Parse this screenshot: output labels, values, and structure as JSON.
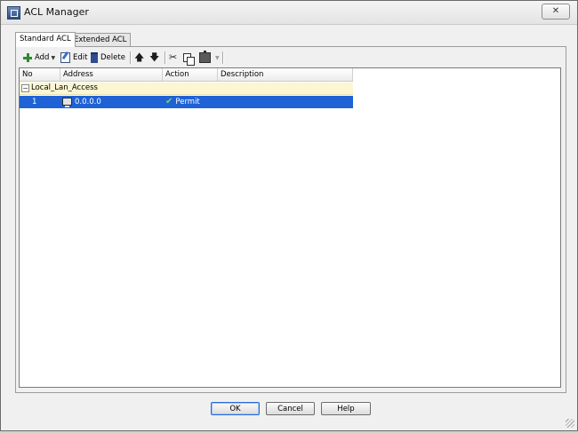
{
  "window": {
    "title": "ACL Manager",
    "close_label": "✕"
  },
  "tabs": [
    {
      "label": "Standard ACL",
      "active": true
    },
    {
      "label": "Extended ACL",
      "active": false
    }
  ],
  "toolbar": {
    "add_label": "Add",
    "edit_label": "Edit",
    "delete_label": "Delete"
  },
  "table": {
    "columns": [
      "No",
      "Address",
      "Action",
      "Description"
    ],
    "groups": [
      {
        "name": "Local_Lan_Access",
        "rows": [
          {
            "no": "1",
            "address": "0.0.0.0",
            "action": "Permit",
            "description": "",
            "selected": true
          }
        ]
      }
    ]
  },
  "buttons": {
    "ok_label": "OK",
    "cancel_label": "Cancel",
    "help_label": "Help"
  },
  "colors": {
    "selection": "#1f62d6",
    "group_row": "#fdf6d3",
    "permit_check": "#7bd55a"
  }
}
